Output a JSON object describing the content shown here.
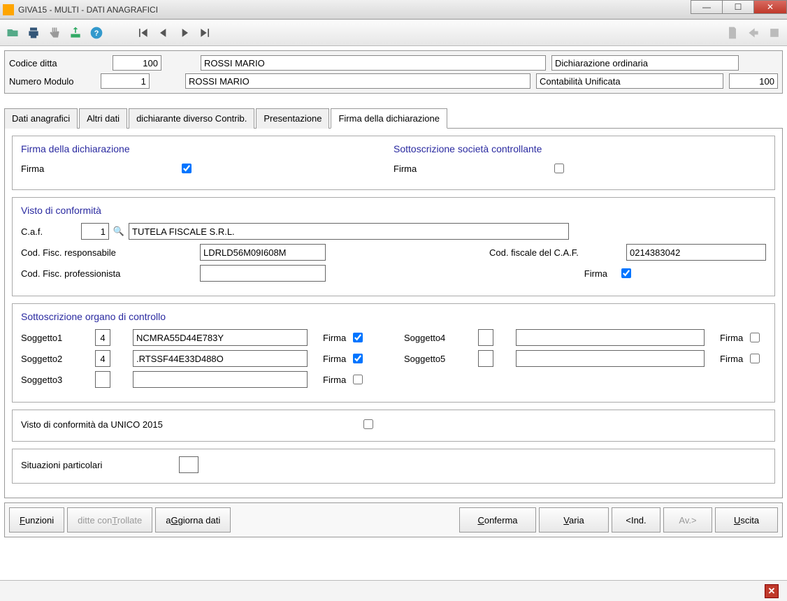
{
  "window": {
    "title": "GIVA15  - MULTI -  DATI ANAGRAFICI"
  },
  "header": {
    "codice_ditta_label": "Codice ditta",
    "codice_ditta": "100",
    "numero_modulo_label": "Numero Modulo",
    "numero_modulo": "1",
    "row1_name": "ROSSI MARIO",
    "row1_type": "Dichiarazione ordinaria",
    "row2_name": "ROSSI MARIO",
    "row2_type": "Contabilità Unificata",
    "row2_num": "100"
  },
  "tabs": {
    "t1": "Dati anagrafici",
    "t2": "Altri dati",
    "t3": "dichiarante diverso Contrib.",
    "t4": "Presentazione",
    "t5": "Firma della dichiarazione"
  },
  "firma_dich": {
    "title": "Firma della dichiarazione",
    "firma_label": "Firma",
    "firma_checked": true,
    "sottoscrizione_title": "Sottoscrizione società controllante",
    "sottoscrizione_checked": false
  },
  "visto": {
    "title": "Visto di conformità",
    "caf_label": "C.a.f.",
    "caf_code": "1",
    "caf_name": "TUTELA FISCALE S.R.L.",
    "cf_resp_label": "Cod. Fisc. responsabile",
    "cf_resp": "LDRLD56M09I608M",
    "cf_caf_label": "Cod. fiscale del C.A.F.",
    "cf_caf": "0214383042",
    "cf_prof_label": "Cod. Fisc. professionista",
    "cf_prof": "",
    "firma_label": "Firma",
    "firma_checked": true
  },
  "organo": {
    "title": "Sottoscrizione organo di controllo",
    "s1_label": "Soggetto1",
    "s1_code": "4",
    "s1_val": "NCMRA55D44E783Y",
    "s1_firma": "Firma",
    "s1_checked": true,
    "s2_label": "Soggetto2",
    "s2_code": "4",
    "s2_val": ".RTSSF44E33D488O",
    "s2_firma": "Firma",
    "s2_checked": true,
    "s3_label": "Soggetto3",
    "s3_code": "",
    "s3_val": "",
    "s3_firma": "Firma",
    "s3_checked": false,
    "s4_label": "Soggetto4",
    "s4_code": "",
    "s4_val": "",
    "s4_firma": "Firma",
    "s4_checked": false,
    "s5_label": "Soggetto5",
    "s5_code": "",
    "s5_val": "",
    "s5_firma": "Firma",
    "s5_checked": false
  },
  "unico": {
    "label": "Visto di conformità da UNICO 2015",
    "checked": false
  },
  "situazioni": {
    "label": "Situazioni particolari",
    "value": ""
  },
  "buttons": {
    "funzioni": "Funzioni",
    "ditte": "ditte conTrollate",
    "aggiorna": "aGgiorna dati",
    "conferma": "Conferma",
    "varia": "Varia",
    "ind": "<Ind.",
    "av": "Av.>",
    "uscita": "Uscita"
  }
}
